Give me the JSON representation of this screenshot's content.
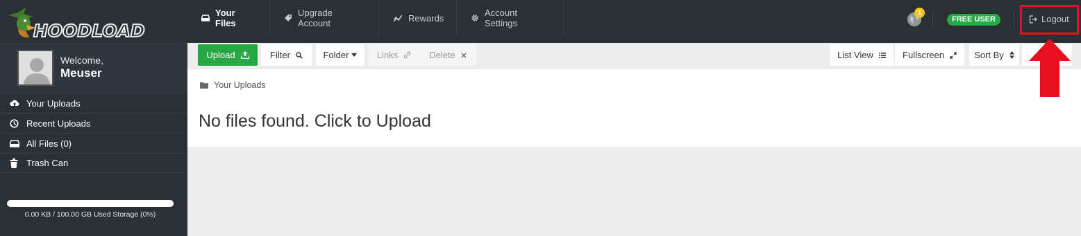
{
  "brand": {
    "name": "HOODLOAD"
  },
  "profile": {
    "welcome": "Welcome,",
    "username": "Meuser"
  },
  "sidebar": {
    "items": [
      {
        "label": "Your Uploads",
        "icon": "cloud-upload-icon"
      },
      {
        "label": "Recent Uploads",
        "icon": "clock-icon"
      },
      {
        "label": "All Files (0)",
        "icon": "drive-icon"
      },
      {
        "label": "Trash Can",
        "icon": "trash-icon"
      }
    ]
  },
  "storage": {
    "used_fraction": 0.0,
    "text": "0.00 KB / 100.00 GB Used Storage (0%)",
    "bar_color": "#28a745"
  },
  "topnav": {
    "tabs": [
      {
        "label": "Your Files",
        "icon": "drive-icon",
        "active": true
      },
      {
        "label": "Upgrade Account",
        "icon": "tag-icon"
      },
      {
        "label": "Rewards",
        "icon": "chart-icon"
      },
      {
        "label": "Account Settings",
        "icon": "gear-icon"
      }
    ],
    "notification_count": "1",
    "badge": "FREE USER",
    "logout": "Logout"
  },
  "toolbar": {
    "upload": "Upload",
    "filter": "Filter",
    "folder": "Folder",
    "links": "Links",
    "delete": "Delete",
    "list_view": "List View",
    "fullscreen": "Fullscreen",
    "sort_by": "Sort By"
  },
  "content": {
    "breadcrumb": "Your Uploads",
    "empty_message": "No files found. Click to Upload"
  },
  "colors": {
    "accent": "#28a745",
    "dark_bg": "#2b2f36",
    "annotation": "#e8101e",
    "notification": "#f5c518"
  }
}
